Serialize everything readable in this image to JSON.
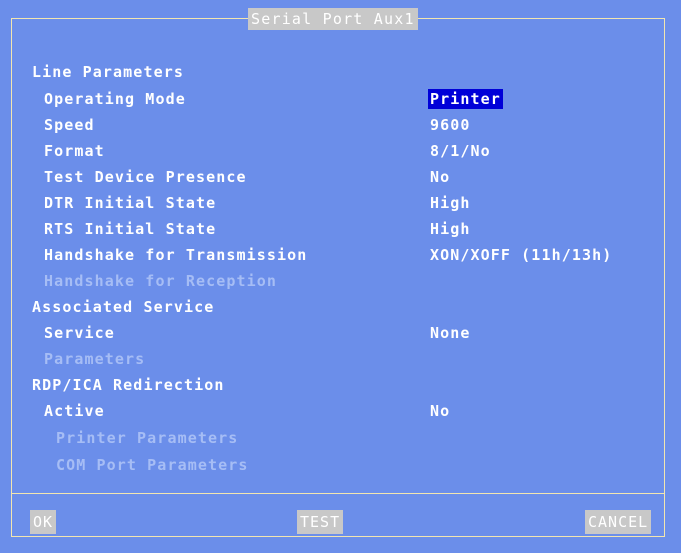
{
  "window": {
    "title": "Serial Port Aux1"
  },
  "sections": {
    "line": "Line Parameters",
    "service": "Associated Service",
    "rdp": "RDP/ICA Redirection"
  },
  "fields": {
    "operating_mode": {
      "label": "Operating Mode",
      "value": "Printer"
    },
    "speed": {
      "label": "Speed",
      "value": "9600"
    },
    "format": {
      "label": "Format",
      "value": "8/1/No"
    },
    "test_device": {
      "label": "Test Device Presence",
      "value": "No"
    },
    "dtr": {
      "label": "DTR Initial State",
      "value": "High"
    },
    "rts": {
      "label": "RTS Initial State",
      "value": "High"
    },
    "hs_tx": {
      "label": "Handshake for Transmission",
      "value": "XON/XOFF (11h/13h)"
    },
    "hs_rx": {
      "label": "Handshake for Reception"
    },
    "service": {
      "label": "Service",
      "value": "None"
    },
    "parameters": {
      "label": "Parameters"
    },
    "active": {
      "label": "Active",
      "value": "No"
    },
    "printer_params": {
      "label": "Printer Parameters"
    },
    "com_params": {
      "label": "COM Port Parameters"
    }
  },
  "buttons": {
    "ok": "OK",
    "test": "TEST",
    "cancel": "CANCEL"
  },
  "colors": {
    "background": "#6b8eea",
    "selected": "#0000d8",
    "disabled_text": "#a6bdf5",
    "border": "#f2e6b0",
    "button": "#c8c8c8"
  }
}
